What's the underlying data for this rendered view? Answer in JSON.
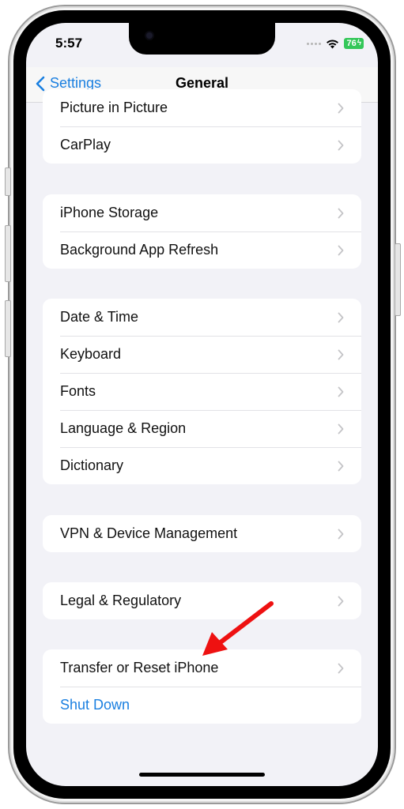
{
  "status_bar": {
    "time": "5:57",
    "battery": "76",
    "icons": [
      "signal-dots-icon",
      "wifi-icon",
      "battery-charging-icon"
    ]
  },
  "navbar": {
    "back_label": "Settings",
    "title": "General"
  },
  "groups": [
    {
      "items": [
        {
          "label": "Picture in Picture"
        },
        {
          "label": "CarPlay"
        }
      ]
    },
    {
      "items": [
        {
          "label": "iPhone Storage"
        },
        {
          "label": "Background App Refresh"
        }
      ]
    },
    {
      "items": [
        {
          "label": "Date & Time"
        },
        {
          "label": "Keyboard"
        },
        {
          "label": "Fonts"
        },
        {
          "label": "Language & Region"
        },
        {
          "label": "Dictionary"
        }
      ]
    },
    {
      "items": [
        {
          "label": "VPN & Device Management"
        }
      ]
    },
    {
      "items": [
        {
          "label": "Legal & Regulatory"
        }
      ]
    },
    {
      "items": [
        {
          "label": "Transfer or Reset iPhone"
        },
        {
          "label": "Shut Down"
        }
      ]
    }
  ],
  "annotation": {
    "type": "red-arrow",
    "target": "Transfer or Reset iPhone",
    "color": "#ee1111"
  },
  "colors": {
    "accent": "#1a7fe0",
    "background": "#f2f2f7",
    "battery": "#34c759"
  }
}
